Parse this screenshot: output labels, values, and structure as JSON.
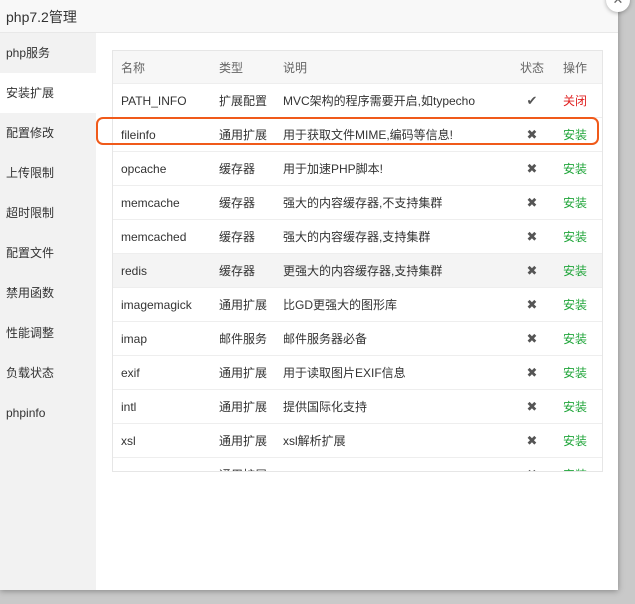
{
  "window": {
    "title": "php7.2管理",
    "close_icon": "close-icon"
  },
  "sidebar": {
    "items": [
      {
        "label": "php服务"
      },
      {
        "label": "安装扩展",
        "active": true
      },
      {
        "label": "配置修改"
      },
      {
        "label": "上传限制"
      },
      {
        "label": "超时限制"
      },
      {
        "label": "配置文件"
      },
      {
        "label": "禁用函数"
      },
      {
        "label": "性能调整"
      },
      {
        "label": "负载状态"
      },
      {
        "label": "phpinfo"
      }
    ]
  },
  "table": {
    "headers": {
      "name": "名称",
      "type": "类型",
      "desc": "说明",
      "status": "状态",
      "action": "操作"
    },
    "rows": [
      {
        "name": "PATH_INFO",
        "type": "扩展配置",
        "desc": "MVC架构的程序需要开启,如typecho",
        "status": "✔",
        "action": "关闭"
      },
      {
        "name": "fileinfo",
        "type": "通用扩展",
        "desc": "用于获取文件MIME,编码等信息!",
        "status": "✖",
        "action": "安装"
      },
      {
        "name": "opcache",
        "type": "缓存器",
        "desc": "用于加速PHP脚本!",
        "status": "✖",
        "action": "安装"
      },
      {
        "name": "memcache",
        "type": "缓存器",
        "desc": "强大的内容缓存器,不支持集群",
        "status": "✖",
        "action": "安装"
      },
      {
        "name": "memcached",
        "type": "缓存器",
        "desc": "强大的内容缓存器,支持集群",
        "status": "✖",
        "action": "安装"
      },
      {
        "name": "redis",
        "type": "缓存器",
        "desc": "更强大的内容缓存器,支持集群",
        "status": "✖",
        "action": "安装"
      },
      {
        "name": "imagemagick",
        "type": "通用扩展",
        "desc": "比GD更强大的图形库",
        "status": "✖",
        "action": "安装"
      },
      {
        "name": "imap",
        "type": "邮件服务",
        "desc": "邮件服务器必备",
        "status": "✖",
        "action": "安装"
      },
      {
        "name": "exif",
        "type": "通用扩展",
        "desc": "用于读取图片EXIF信息",
        "status": "✖",
        "action": "安装"
      },
      {
        "name": "intl",
        "type": "通用扩展",
        "desc": "提供国际化支持",
        "status": "✖",
        "action": "安装"
      },
      {
        "name": "xsl",
        "type": "通用扩展",
        "desc": "xsl解析扩展",
        "status": "✖",
        "action": "安装"
      },
      {
        "name": "",
        "type": "通用扩展",
        "desc": "",
        "status": "✖",
        "action": "安装"
      }
    ]
  },
  "colors": {
    "accent": "#20a53a",
    "danger": "#e02020",
    "highlight": "#f05a1a"
  }
}
